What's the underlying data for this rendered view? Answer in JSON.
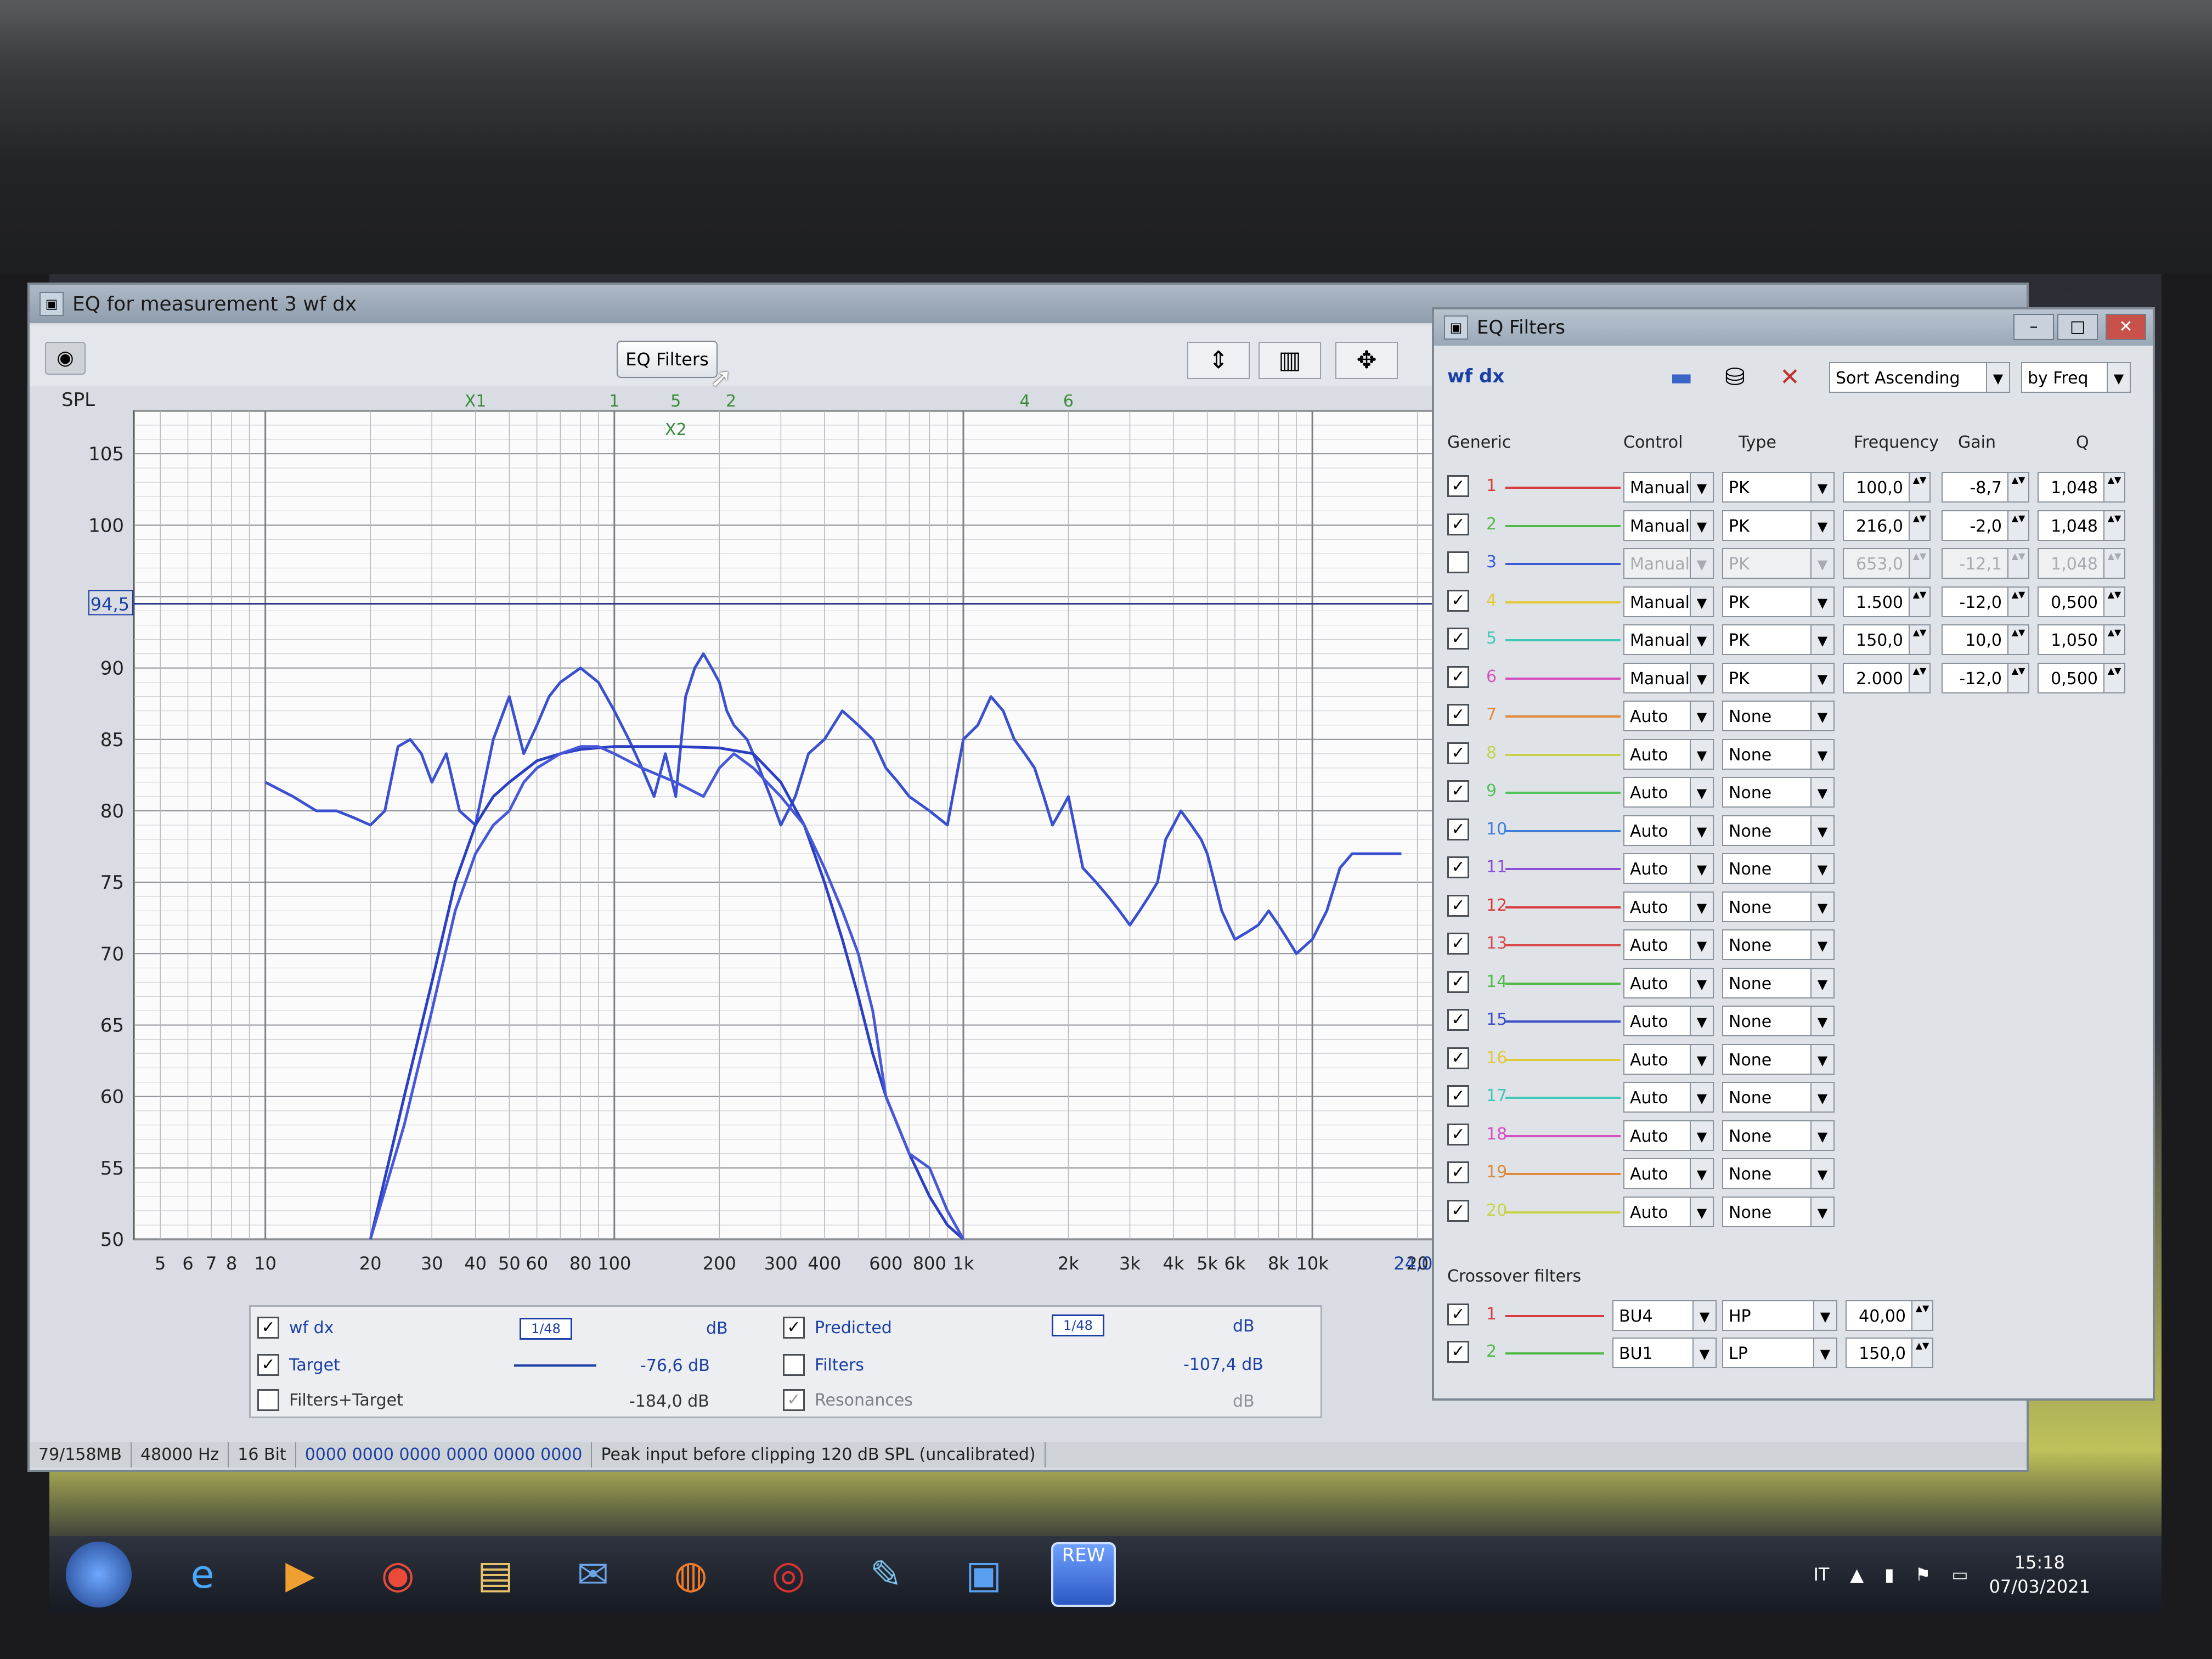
{
  "main_window": {
    "title": "EQ for measurement 3 wf dx",
    "eq_filters_button": "EQ Filters",
    "spl_label": "SPL"
  },
  "chart_data": {
    "type": "line",
    "ylabel": "SPL",
    "ylim": [
      50,
      108
    ],
    "xscale": "log",
    "xlim": [
      4.2,
      24000
    ],
    "yticks": [
      50,
      55,
      60,
      65,
      70,
      75,
      80,
      85,
      90,
      95,
      100,
      105
    ],
    "ytick_labels": [
      "50",
      "55",
      "60",
      "65",
      "70",
      "75",
      "80",
      "85",
      "90",
      "",
      "100",
      "105"
    ],
    "xticks": [
      5,
      6,
      7,
      8,
      10,
      20,
      30,
      40,
      50,
      60,
      80,
      100,
      200,
      300,
      400,
      600,
      800,
      1000,
      2000,
      3000,
      4000,
      5000,
      6000,
      8000,
      10000,
      20000
    ],
    "xtick_labels": [
      "5",
      "6",
      "7",
      "8",
      "10",
      "20",
      "30",
      "40",
      "50",
      "60",
      "80",
      "100",
      "200",
      "300",
      "400",
      "600",
      "800",
      "1k",
      "2k",
      "3k",
      "4k",
      "5k",
      "6k",
      "8k",
      "10k",
      "20"
    ],
    "target_level": {
      "value": 94.5,
      "label": "94,5"
    },
    "x_end_label": "24,0k",
    "markers": [
      {
        "label": "X1",
        "freq": 40,
        "row": 0
      },
      {
        "label": "1",
        "freq": 100,
        "row": 0
      },
      {
        "label": "5",
        "freq": 150,
        "row": 0
      },
      {
        "label": "2",
        "freq": 216,
        "row": 0
      },
      {
        "label": "4",
        "freq": 1500,
        "row": 0
      },
      {
        "label": "6",
        "freq": 2000,
        "row": 0
      },
      {
        "label": "X2",
        "freq": 150,
        "row": 1
      }
    ],
    "grid": true,
    "series": [
      {
        "name": "wf dx",
        "color": "#3a50d0",
        "x": [
          10,
          12,
          14,
          16,
          18,
          20,
          22,
          24,
          26,
          28,
          30,
          33,
          36,
          40,
          45,
          50,
          55,
          60,
          65,
          70,
          80,
          90,
          100,
          110,
          120,
          130,
          140,
          150,
          160,
          170,
          180,
          190,
          200,
          210,
          220,
          240,
          260,
          280,
          300,
          330,
          360,
          400,
          450,
          500,
          550,
          600,
          650,
          700,
          800,
          900,
          1000,
          1100,
          1200,
          1300,
          1400,
          1500,
          1600,
          1700,
          1800,
          1900,
          2000,
          2200,
          2400,
          2600,
          2800,
          3000,
          3200,
          3400,
          3600,
          3800,
          4000,
          4200,
          4500,
          4800,
          5000,
          5500,
          6000,
          6500,
          7000,
          7500,
          8000,
          8500,
          9000,
          10000,
          11000,
          12000,
          13000,
          14000,
          15000,
          16000,
          18000
        ],
        "y": [
          82,
          81,
          80,
          80,
          79.5,
          79,
          80,
          84.5,
          85,
          84,
          82,
          84,
          80,
          79,
          85,
          88,
          84,
          86,
          88,
          89,
          90,
          89,
          87,
          85,
          83,
          81,
          84,
          81,
          88,
          90,
          91,
          90,
          89,
          87,
          86,
          85,
          83,
          81,
          79,
          81,
          84,
          85,
          87,
          86,
          85,
          83,
          82,
          81,
          80,
          79,
          85,
          86,
          88,
          87,
          85,
          84,
          83,
          81,
          79,
          80,
          81,
          76,
          75,
          74,
          73,
          72,
          73,
          74,
          75,
          78,
          79,
          80,
          79,
          78,
          77,
          73,
          71,
          71.5,
          72,
          73,
          72,
          71,
          70,
          71,
          73,
          76,
          77,
          77,
          77,
          77,
          77
        ]
      },
      {
        "name": "Target",
        "color": "#2a3fc4",
        "x": [
          20,
          25,
          30,
          35,
          40,
          45,
          50,
          60,
          70,
          80,
          100,
          150,
          200,
          250,
          300,
          350,
          400,
          450,
          500,
          550,
          600,
          700,
          800,
          900,
          1000
        ],
        "y": [
          50,
          60,
          68,
          75,
          79,
          81,
          82,
          83.5,
          84,
          84.3,
          84.5,
          84.5,
          84.4,
          84,
          82,
          79,
          75,
          71,
          67,
          63,
          60,
          56,
          53,
          51,
          50
        ]
      },
      {
        "name": "Predicted",
        "color": "#4657d8",
        "x": [
          20,
          25,
          30,
          35,
          40,
          45,
          50,
          55,
          60,
          70,
          80,
          90,
          100,
          120,
          150,
          180,
          200,
          220,
          250,
          300,
          350,
          400,
          450,
          500,
          550,
          600,
          700,
          800,
          900,
          1000
        ],
        "y": [
          50,
          58,
          66,
          73,
          77,
          79,
          80,
          82,
          83,
          84,
          84.5,
          84.5,
          84,
          83,
          82,
          81,
          83,
          84,
          83,
          81,
          79,
          76,
          73,
          70,
          66,
          60,
          56,
          55,
          52,
          49
        ]
      }
    ]
  },
  "legend": {
    "wf_dx": {
      "label": "wf dx",
      "checked": true,
      "smoothing": "1/48",
      "value": "dB"
    },
    "target": {
      "label": "Target",
      "checked": true,
      "value": "-76,6 dB"
    },
    "filters_target": {
      "label": "Filters+Target",
      "checked": false,
      "value": "-184,0 dB"
    },
    "predicted": {
      "label": "Predicted",
      "checked": true,
      "smoothing": "1/48",
      "value": "dB"
    },
    "filters": {
      "label": "Filters",
      "checked": false,
      "value": "-107,4 dB"
    },
    "resonances": {
      "label": "Resonances",
      "checked": true,
      "value": "dB"
    }
  },
  "statusbar": {
    "memory": "79/158MB",
    "rate": "48000 Hz",
    "bits": "16 Bit",
    "levels": "0000 0000  0000 0000  0000 0000",
    "message": "Peak input before clipping 120 dB SPL (uncalibrated)"
  },
  "eq_window": {
    "title": "EQ Filters",
    "measurement": "wf dx",
    "sort": "Sort Ascending",
    "sort_by": "by Freq",
    "equaliser": "Generic",
    "columns": {
      "control": "Control",
      "type": "Type",
      "frequency": "Frequency",
      "gain": "Gain",
      "q": "Q"
    },
    "filters": [
      {
        "n": "1",
        "checked": true,
        "color": "#d83c3c",
        "control": "Manual",
        "type": "PK",
        "freq": "100,0",
        "gain": "-8,7",
        "q": "1,048",
        "enabled": true
      },
      {
        "n": "2",
        "checked": true,
        "color": "#52b948",
        "control": "Manual",
        "type": "PK",
        "freq": "216,0",
        "gain": "-2,0",
        "q": "1,048",
        "enabled": true
      },
      {
        "n": "3",
        "checked": false,
        "color": "#3c5bd4",
        "control": "Manual",
        "type": "PK",
        "freq": "653,0",
        "gain": "-12,1",
        "q": "1,048",
        "enabled": false
      },
      {
        "n": "4",
        "checked": true,
        "color": "#e2c83a",
        "control": "Manual",
        "type": "PK",
        "freq": "1.500",
        "gain": "-12,0",
        "q": "0,500",
        "enabled": true
      },
      {
        "n": "5",
        "checked": true,
        "color": "#3fc7b7",
        "control": "Manual",
        "type": "PK",
        "freq": "150,0",
        "gain": "10,0",
        "q": "1,050",
        "enabled": true
      },
      {
        "n": "6",
        "checked": true,
        "color": "#d64fc1",
        "control": "Manual",
        "type": "PK",
        "freq": "2.000",
        "gain": "-12,0",
        "q": "0,500",
        "enabled": true
      },
      {
        "n": "7",
        "checked": true,
        "color": "#e08a3a",
        "control": "Auto",
        "type": "None"
      },
      {
        "n": "8",
        "checked": true,
        "color": "#c7d24a",
        "control": "Auto",
        "type": "None"
      },
      {
        "n": "9",
        "checked": true,
        "color": "#54c25a",
        "control": "Auto",
        "type": "None"
      },
      {
        "n": "10",
        "checked": true,
        "color": "#3d7fd8",
        "control": "Auto",
        "type": "None"
      },
      {
        "n": "11",
        "checked": true,
        "color": "#8a4fd6",
        "control": "Auto",
        "type": "None"
      },
      {
        "n": "12",
        "checked": true,
        "color": "#d83c3c",
        "control": "Auto",
        "type": "None"
      },
      {
        "n": "13",
        "checked": true,
        "color": "#d84a4a",
        "control": "Auto",
        "type": "None"
      },
      {
        "n": "14",
        "checked": true,
        "color": "#52b948",
        "control": "Auto",
        "type": "None"
      },
      {
        "n": "15",
        "checked": true,
        "color": "#3c4fc8",
        "control": "Auto",
        "type": "None"
      },
      {
        "n": "16",
        "checked": true,
        "color": "#e2c83a",
        "control": "Auto",
        "type": "None"
      },
      {
        "n": "17",
        "checked": true,
        "color": "#3fc7b7",
        "control": "Auto",
        "type": "None"
      },
      {
        "n": "18",
        "checked": true,
        "color": "#d64fc1",
        "control": "Auto",
        "type": "None"
      },
      {
        "n": "19",
        "checked": true,
        "color": "#e08a3a",
        "control": "Auto",
        "type": "None"
      },
      {
        "n": "20",
        "checked": true,
        "color": "#c7d24a",
        "control": "Auto",
        "type": "None"
      }
    ],
    "crossover_label": "Crossover filters",
    "crossovers": [
      {
        "n": "1",
        "checked": true,
        "color": "#d83c3c",
        "filter": "BU4",
        "type": "HP",
        "freq": "40,00"
      },
      {
        "n": "2",
        "checked": true,
        "color": "#52b948",
        "filter": "BU1",
        "type": "LP",
        "freq": "150,0"
      }
    ]
  },
  "taskbar": {
    "rew_label": "REW",
    "language": "IT",
    "time": "15:18",
    "date": "07/03/2021"
  }
}
